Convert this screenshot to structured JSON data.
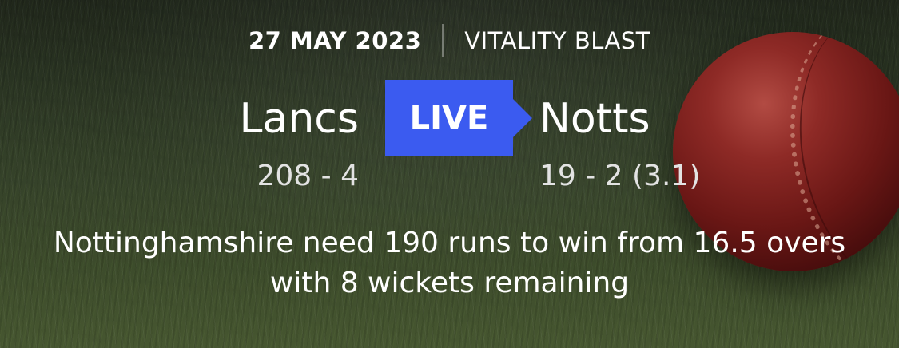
{
  "match": {
    "date": "27 MAY 2023",
    "competition": "VITALITY BLAST",
    "status_badge": "LIVE",
    "home": {
      "name": "Lancs",
      "score": "208 - 4"
    },
    "away": {
      "name": "Notts",
      "score": "19 - 2 (3.1)"
    },
    "summary": "Nottinghamshire need 190 runs to win from 16.5 overs with 8 wickets remaining"
  },
  "colors": {
    "live_badge": "#3b5bf0",
    "text": "#ffffff",
    "score_text": "#e3e3e3"
  },
  "background": {
    "image": "cricket-ball-on-grass"
  }
}
